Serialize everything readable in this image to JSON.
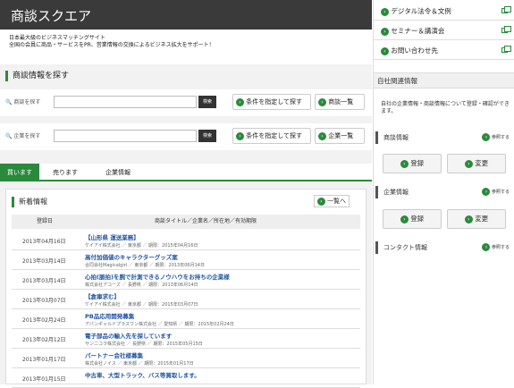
{
  "header": {
    "title": "商談スクエア"
  },
  "subtitle": {
    "line1": "日本最大級のビジネスマッチングサイト",
    "line2": "全国の会員に商品・サービスをPR、営業情報の交換によるビジネス拡大をサポート！"
  },
  "search": {
    "section_title": "商談情報を探す",
    "product_label": "商談を探す",
    "company_label": "企業を探す",
    "go_label": "検索",
    "cond_label": "条件を指定して探す",
    "list_label": "商談一覧",
    "company_list_label": "企業一覧"
  },
  "tabs": [
    "買います",
    "売ります",
    "企業情報"
  ],
  "news": {
    "title": "新着情報",
    "more": "一覧へ",
    "col_date": "登録日",
    "col_info": "商談タイトル／企業名／所在地／有効期限",
    "rows": [
      {
        "date": "2013年04月16日",
        "title": "【山形県 運送業務】",
        "company": "ケイアイ株式会社 ／ 東京都 ／ 期限：2015年04月16日"
      },
      {
        "date": "2013年03月14日",
        "title": "高付加価値のキャラクターグッズ案",
        "company": "合同会社Magicalgirl ／ 東京都 ／ 期限：2013年06月14日"
      },
      {
        "date": "2013年03月14日",
        "title": "心拍(脈拍)を腕で計測できるノウハウをお持ちの企業様",
        "company": "株式会社アコーズ ／ 長野県 ／ 期限：2013年06月14日"
      },
      {
        "date": "2013年03月07日",
        "title": "【倉庫求む】",
        "company": "ケイアイ株式会社 ／ 東京都 ／ 期限：2015年03月07日"
      },
      {
        "date": "2013年02月24日",
        "title": "PB品応用開発募集",
        "company": "アパンギャルドプラスワン株式会社 ／ 愛知県 ／ 期限：2015年02月24日"
      },
      {
        "date": "2013年02月12日",
        "title": "電子部品の輸入先を探しています",
        "company": "サンニコラ株式会社 ／ 長野県 ／ 期限：2015年05月15日"
      },
      {
        "date": "2013年01月17日",
        "title": "パートナー会社様募集",
        "company": "株式会社ノイス ／ 東京都 ／ 期限：2015年01月17日"
      },
      {
        "date": "2013年01月15日",
        "title": "中古車、大型トラック、バス等買取します。",
        "company": ""
      }
    ]
  },
  "right": {
    "links": [
      "デジタル法令＆文例",
      "セミナー＆講演会",
      "お問い合わせ先"
    ],
    "title": "自社関連情報",
    "desc": "自社の企業情報・商談情報について登録・確認ができます。",
    "sec_deal": "商談情報",
    "sec_company": "企業情報",
    "sec_contact": "コンタクト情報",
    "more": "参照する",
    "register": "登録",
    "edit": "変更"
  }
}
